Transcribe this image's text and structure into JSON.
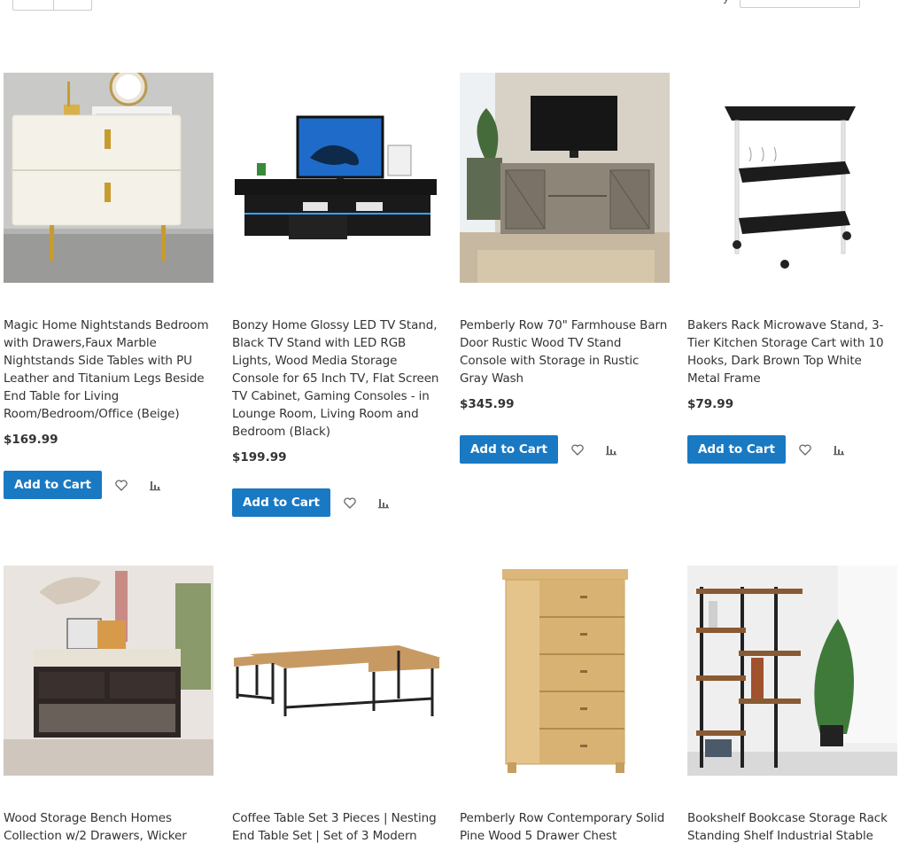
{
  "toolbar": {
    "sort_label": "y",
    "icons": [
      "grid-view-icon",
      "list-view-icon"
    ]
  },
  "products": [
    {
      "name": "Magic Home Nightstands Bedroom with Drawers,Faux Marble Nightstands Side Tables with PU Leather and Titanium Legs Beside End Table for Living Room/Bedroom/Office (Beige)",
      "price": "$169.99",
      "cart_label": "Add to Cart"
    },
    {
      "name": "Bonzy Home Glossy LED TV Stand, Black TV Stand with LED RGB Lights, Wood Media Storage Console for 65 Inch TV, Flat Screen TV Cabinet, Gaming Consoles - in Lounge Room, Living Room and Bedroom (Black)",
      "price": "$199.99",
      "cart_label": "Add to Cart"
    },
    {
      "name": "Pemberly Row 70\" Farmhouse Barn Door Rustic Wood TV Stand Console with Storage in Rustic Gray Wash",
      "price": "$345.99",
      "cart_label": "Add to Cart"
    },
    {
      "name": "Bakers Rack Microwave Stand, 3-Tier Kitchen Storage Cart with 10 Hooks, Dark Brown Top White Metal Frame",
      "price": "$79.99",
      "cart_label": "Add to Cart"
    },
    {
      "name": "Wood Storage Bench Homes Collection w/2 Drawers, Wicker"
    },
    {
      "name": "Coffee Table Set 3 Pieces | Nesting End Table Set | Set of 3 Modern"
    },
    {
      "name": "Pemberly Row Contemporary Solid Pine Wood 5 Drawer Chest"
    },
    {
      "name": "Bookshelf Bookcase Storage Rack Standing Shelf Industrial Stable"
    }
  ],
  "colors": {
    "primary_button": "#1979c3",
    "text": "#333333",
    "icon": "#666666"
  }
}
